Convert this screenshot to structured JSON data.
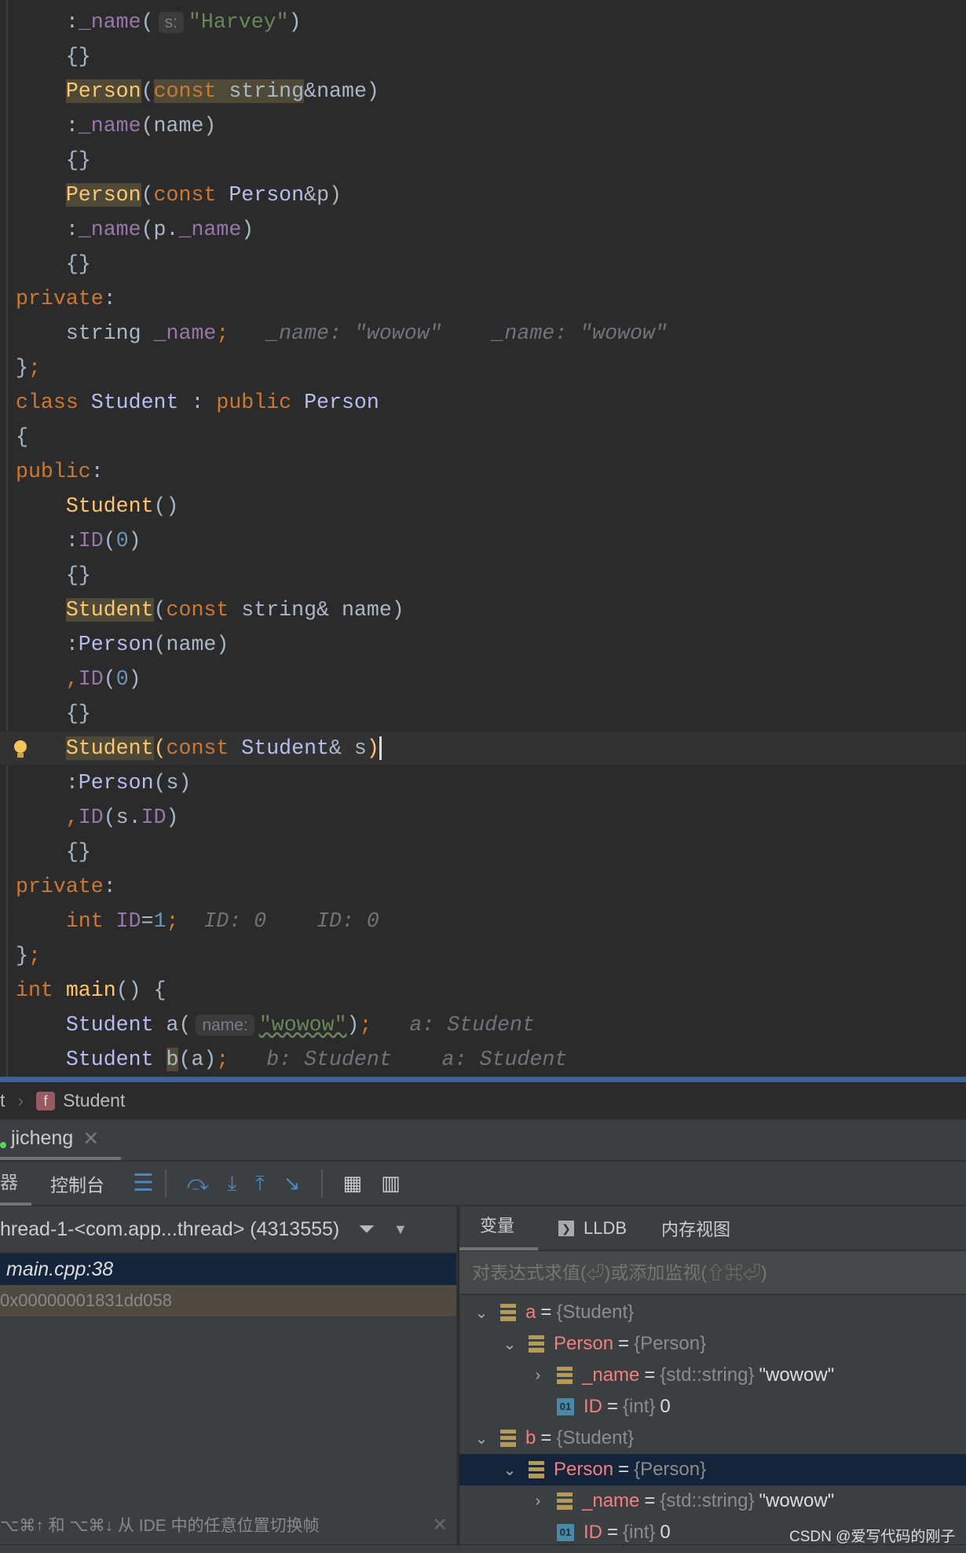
{
  "code": {
    "lines": [
      [
        [
          "tx",
          "    :"
        ],
        [
          "fd",
          "_name"
        ],
        [
          "tx",
          "("
        ],
        [
          "pb",
          "s:"
        ],
        [
          "st",
          "\"Harvey\""
        ],
        [
          "tx",
          ")"
        ]
      ],
      [
        [
          "tx",
          "    {}"
        ]
      ],
      [
        [
          "tx",
          "    "
        ],
        [
          "fn hl",
          "Person"
        ],
        [
          "tx",
          "("
        ],
        [
          "kw hl",
          "const "
        ],
        [
          "tx hl",
          "string"
        ],
        [
          "tx",
          "&name)"
        ]
      ],
      [
        [
          "tx",
          "    :"
        ],
        [
          "fd",
          "_name"
        ],
        [
          "tx",
          "(name)"
        ]
      ],
      [
        [
          "tx",
          "    {}"
        ]
      ],
      [
        [
          "tx",
          "    "
        ],
        [
          "fn hl",
          "Person"
        ],
        [
          "tx",
          "("
        ],
        [
          "kw",
          "const "
        ],
        [
          "ty",
          "Person"
        ],
        [
          "tx",
          "&p)"
        ]
      ],
      [
        [
          "tx",
          "    :"
        ],
        [
          "fd",
          "_name"
        ],
        [
          "tx",
          "(p."
        ],
        [
          "fd",
          "_name"
        ],
        [
          "tx",
          ")"
        ]
      ],
      [
        [
          "tx",
          "    {}"
        ]
      ],
      [
        [
          "kw",
          "private"
        ],
        [
          "tx",
          ":"
        ]
      ],
      [
        [
          "tx",
          "    string "
        ],
        [
          "fd",
          "_name"
        ],
        [
          "kw",
          ";"
        ],
        [
          "ih",
          "   _name: \"wowow\"    _name: \"wowow\""
        ]
      ],
      [
        [
          "tx",
          "}"
        ],
        [
          "kw",
          ";"
        ]
      ],
      [
        [
          "kw",
          "class "
        ],
        [
          "ty",
          "Student"
        ],
        [
          "tx",
          " : "
        ],
        [
          "kw",
          "public "
        ],
        [
          "ty",
          "Person"
        ]
      ],
      [
        [
          "tx",
          "{"
        ]
      ],
      [
        [
          "kw",
          "public"
        ],
        [
          "tx",
          ":"
        ]
      ],
      [
        [
          "tx",
          "    "
        ],
        [
          "fn",
          "Student"
        ],
        [
          "tx",
          "()"
        ]
      ],
      [
        [
          "tx",
          "    :"
        ],
        [
          "fd",
          "ID"
        ],
        [
          "tx",
          "("
        ],
        [
          "nm",
          "0"
        ],
        [
          "tx",
          ")"
        ]
      ],
      [
        [
          "tx",
          "    {}"
        ]
      ],
      [
        [
          "tx",
          "    "
        ],
        [
          "fn hl",
          "Student"
        ],
        [
          "tx",
          "("
        ],
        [
          "kw",
          "const "
        ],
        [
          "tx",
          "string& name)"
        ]
      ],
      [
        [
          "tx",
          "    :"
        ],
        [
          "ty",
          "Person"
        ],
        [
          "tx",
          "(name)"
        ]
      ],
      [
        [
          "kw",
          "    ,"
        ],
        [
          "fd",
          "ID"
        ],
        [
          "tx",
          "("
        ],
        [
          "nm",
          "0"
        ],
        [
          "tx",
          ")"
        ]
      ],
      [
        [
          "tx",
          "    {}"
        ]
      ],
      [
        [
          "tx",
          "    "
        ],
        [
          "fn hl",
          "Student"
        ],
        [
          "fn",
          "("
        ],
        [
          "kw",
          "const "
        ],
        [
          "ty",
          "Student"
        ],
        [
          "tx",
          "& s"
        ],
        [
          "fn caret",
          ")"
        ]
      ],
      [
        [
          "tx",
          "    :"
        ],
        [
          "ty",
          "Person"
        ],
        [
          "tx",
          "(s)"
        ]
      ],
      [
        [
          "kw",
          "    ,"
        ],
        [
          "fd",
          "ID"
        ],
        [
          "tx",
          "(s."
        ],
        [
          "fd",
          "ID"
        ],
        [
          "tx",
          ")"
        ]
      ],
      [
        [
          "tx",
          "    {}"
        ]
      ],
      [
        [
          "kw",
          "private"
        ],
        [
          "tx",
          ":"
        ]
      ],
      [
        [
          "kw",
          "    int "
        ],
        [
          "fd",
          "ID"
        ],
        [
          "tx",
          "="
        ],
        [
          "nm",
          "1"
        ],
        [
          "kw",
          ";"
        ],
        [
          "ih",
          "  ID: 0    ID: 0"
        ]
      ],
      [
        [
          "tx",
          "}"
        ],
        [
          "kw",
          ";"
        ]
      ],
      [
        [
          "kw",
          "int "
        ],
        [
          "fn",
          "main"
        ],
        [
          "tx",
          "() {"
        ]
      ],
      [
        [
          "ty",
          "    Student "
        ],
        [
          "tx",
          "a("
        ],
        [
          "pb",
          "name:"
        ],
        [
          "st sq",
          "\"wowow\""
        ],
        [
          "tx",
          ")"
        ],
        [
          "kw",
          ";"
        ],
        [
          "ih",
          "   a: Student"
        ]
      ],
      [
        [
          "ty",
          "    Student "
        ],
        [
          "tx hl",
          "b"
        ],
        [
          "tx",
          "(a)"
        ],
        [
          "kw",
          ";"
        ],
        [
          "ih",
          "   b: Student    a: Student"
        ]
      ]
    ],
    "current_line": 21
  },
  "breadcrumb": {
    "prev": "t",
    "current": "Student",
    "icon": "f"
  },
  "tabs": {
    "run_config": "jicheng"
  },
  "toolbar": {
    "left_tab": "器",
    "console": "控制台"
  },
  "frames": {
    "thread": "hread-1-<com.app...thread> (4313555)",
    "items": [
      "main.cpp:38",
      "0x00000001831dd058"
    ],
    "hint": "⌥⌘↑ 和 ⌥⌘↓ 从 IDE 中的任意位置切换帧"
  },
  "vars_tabs": [
    "变量",
    "LLDB",
    "内存视图"
  ],
  "eval_placeholder": "对表达式求值(⏎)或添加监视(⇧⌘⏎)",
  "tree": [
    {
      "indent": 0,
      "chev": "v",
      "icon": "stack",
      "name": "a",
      "type": "{Student}",
      "value": ""
    },
    {
      "indent": 1,
      "chev": "v",
      "icon": "stack",
      "name": "Person",
      "type": "{Person}",
      "value": ""
    },
    {
      "indent": 2,
      "chev": ">",
      "icon": "stack",
      "name": "_name",
      "type": "{std::string}",
      "value": "\"wowow\""
    },
    {
      "indent": 2,
      "chev": "",
      "icon": "prim",
      "name": "ID",
      "type": "{int}",
      "value": "0"
    },
    {
      "indent": 0,
      "chev": "v",
      "icon": "stack",
      "name": "b",
      "type": "{Student}",
      "value": ""
    },
    {
      "indent": 1,
      "chev": "v",
      "icon": "stack",
      "name": "Person",
      "type": "{Person}",
      "value": "",
      "selected": true
    },
    {
      "indent": 2,
      "chev": ">",
      "icon": "stack",
      "name": "_name",
      "type": "{std::string}",
      "value": "\"wowow\""
    },
    {
      "indent": 2,
      "chev": "",
      "icon": "prim",
      "name": "ID",
      "type": "{int}",
      "value": "0"
    }
  ],
  "prim_label": "01",
  "watermark": "CSDN @爱写代码的刚子"
}
